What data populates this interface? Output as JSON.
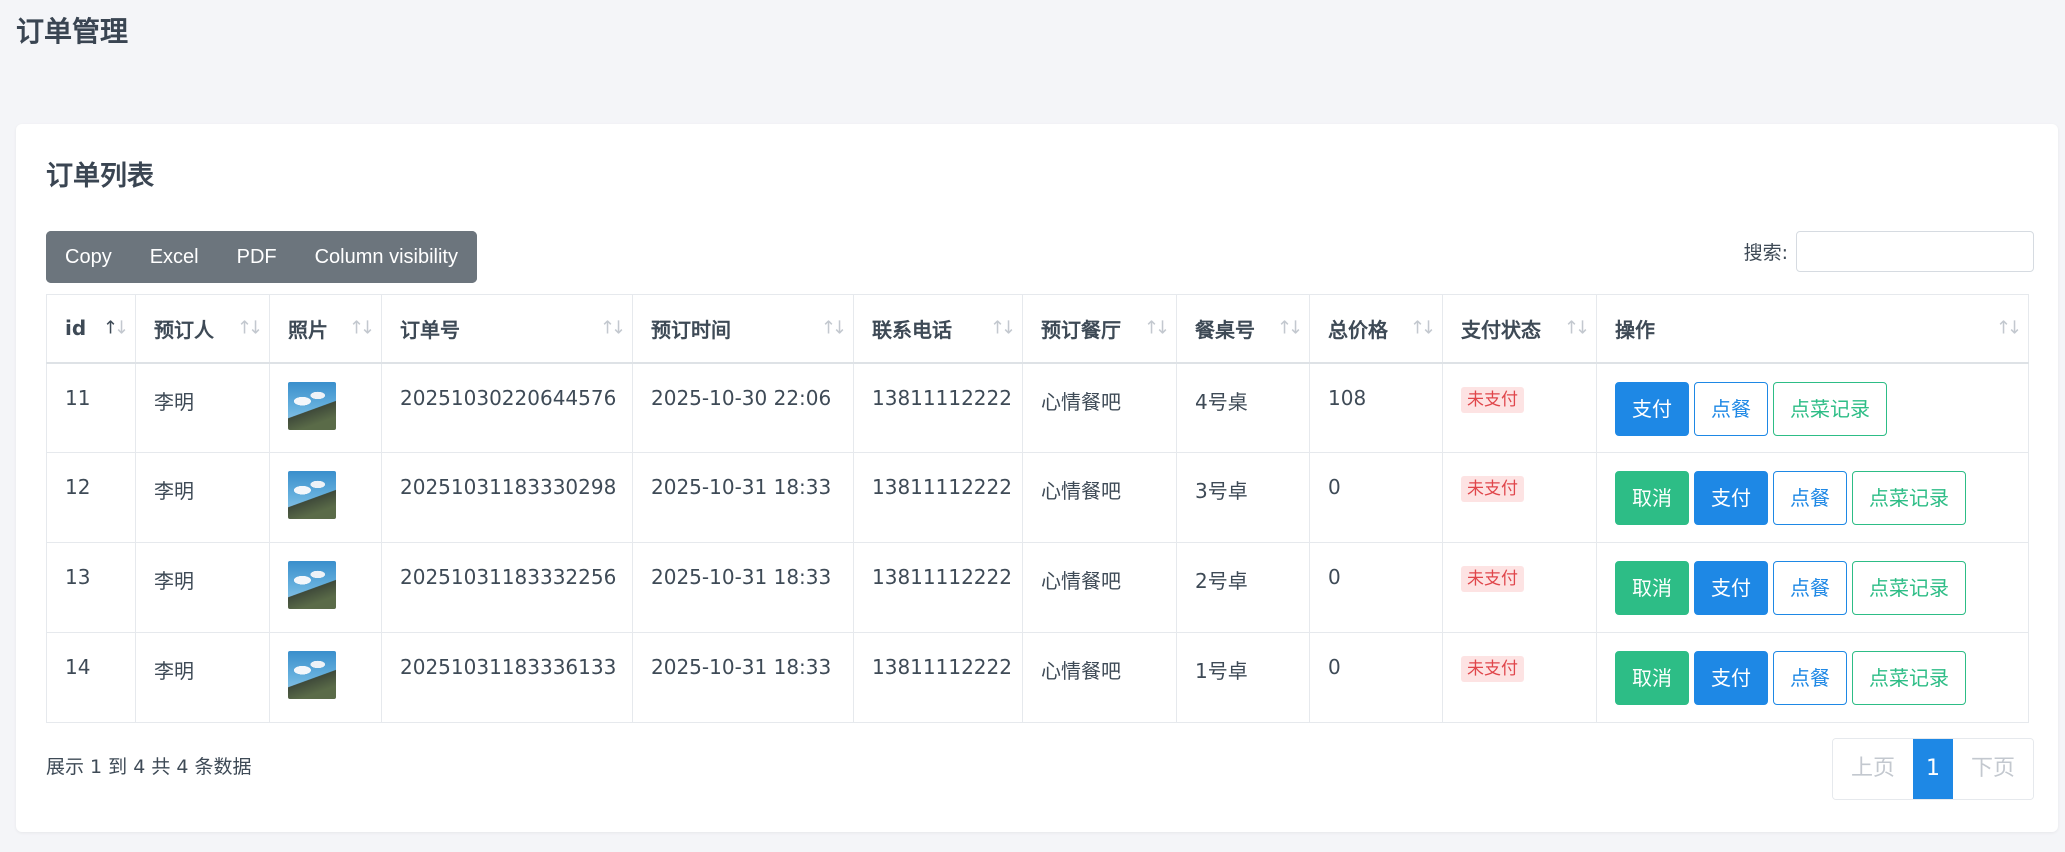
{
  "page": {
    "title": "订单管理"
  },
  "card": {
    "title": "订单列表"
  },
  "toolbar": {
    "buttons": [
      "Copy",
      "Excel",
      "PDF",
      "Column visibility"
    ]
  },
  "search": {
    "label": "搜索:",
    "value": ""
  },
  "table": {
    "columns": [
      "id",
      "预订人",
      "照片",
      "订单号",
      "预订时间",
      "联系电话",
      "预订餐厅",
      "餐桌号",
      "总价格",
      "支付状态",
      "操作"
    ],
    "sort": {
      "column": "id",
      "direction": "asc"
    },
    "rows": [
      {
        "id": "11",
        "name": "李明",
        "photo": "photo-thumbnail",
        "order_no": "20251030220644576",
        "time": "2025-10-30 22:06",
        "phone": "13811112222",
        "restaurant": "心情餐吧",
        "table_no": "4号桌",
        "price": "108",
        "status": "未支付",
        "actions": [
          "支付",
          "点餐",
          "点菜记录"
        ]
      },
      {
        "id": "12",
        "name": "李明",
        "photo": "photo-thumbnail",
        "order_no": "20251031183330298",
        "time": "2025-10-31 18:33",
        "phone": "13811112222",
        "restaurant": "心情餐吧",
        "table_no": "3号卓",
        "price": "0",
        "status": "未支付",
        "actions": [
          "取消",
          "支付",
          "点餐",
          "点菜记录"
        ]
      },
      {
        "id": "13",
        "name": "李明",
        "photo": "photo-thumbnail",
        "order_no": "20251031183332256",
        "time": "2025-10-31 18:33",
        "phone": "13811112222",
        "restaurant": "心情餐吧",
        "table_no": "2号卓",
        "price": "0",
        "status": "未支付",
        "actions": [
          "取消",
          "支付",
          "点餐",
          "点菜记录"
        ]
      },
      {
        "id": "14",
        "name": "李明",
        "photo": "photo-thumbnail",
        "order_no": "20251031183336133",
        "time": "2025-10-31 18:33",
        "phone": "13811112222",
        "restaurant": "心情餐吧",
        "table_no": "1号卓",
        "price": "0",
        "status": "未支付",
        "actions": [
          "取消",
          "支付",
          "点餐",
          "点菜记录"
        ]
      }
    ]
  },
  "footer": {
    "info": "展示 1 到 4 共 4 条数据"
  },
  "pagination": {
    "prev": "上页",
    "current": "1",
    "next": "下页"
  },
  "colors": {
    "primary": "#1e88e5",
    "success": "#2dbd86",
    "danger": "#e0464b",
    "toolbar": "#6c757d"
  }
}
